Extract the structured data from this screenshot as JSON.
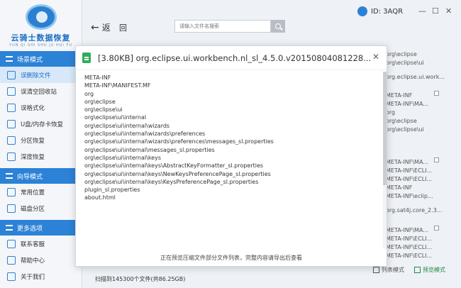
{
  "sidebar": {
    "logo": {
      "title": "云骑士数据恢复",
      "subtitle": "YUN QI SHI SHU JU HUI FU"
    },
    "sections": [
      {
        "title": "场景模式",
        "items": [
          "误删除文件",
          "误清空回收站",
          "误格式化",
          "U盘/内存卡恢复",
          "分区恢复",
          "深度恢复"
        ]
      },
      {
        "title": "向导模式",
        "items": [
          "常用位置",
          "磁盘分区"
        ]
      },
      {
        "title": "更多选项",
        "items": [
          "联系客服",
          "帮助中心",
          "关于我们"
        ]
      }
    ]
  },
  "topbar": {
    "back_label": "返",
    "back_label2": "回",
    "search_placeholder": "请输入文件名搜索",
    "user_id": "ID: 3AQR",
    "min": "—",
    "restore": "☐",
    "close": "✕"
  },
  "right_list": [
    "org\\eclipse",
    "org\\eclipse\\ui",
    "org.eclipse.ui.work...",
    "META-INF",
    "META-INF\\MA...",
    "org",
    "org\\eclipse",
    "org\\eclipse\\ui",
    "META-INF\\MA...",
    "META-INF\\ECLI...",
    "META-INF\\ECLI...",
    "META-INF",
    "META-INF\\eclip...",
    "org.sat4j.core_2.3...",
    "META-INF\\MA...",
    "META-INF\\ECLI...",
    "META-INF\\ECLI...",
    "META-INF\\ECLI..."
  ],
  "status": {
    "scan_text": "扫描到145300个文件(共86.25GB)",
    "list_mode": "列表模式",
    "preview_mode": "预览模式"
  },
  "modal": {
    "title": "[3.80KB] org.eclipse.ui.workbench.nl_sl_4.5.0.v20150804081228...",
    "close": "✕",
    "lines": [
      "META-INF",
      "META-INF\\MANIFEST.MF",
      "org",
      "org\\eclipse",
      "org\\eclipse\\ui",
      "org\\eclipse\\ui\\internal",
      "org\\eclipse\\ui\\internal\\wizards",
      "org\\eclipse\\ui\\internal\\wizards\\preferences",
      "org\\eclipse\\ui\\internal\\wizards\\preferences\\messages_sl.properties",
      "org\\eclipse\\ui\\internal\\messages_sl.properties",
      "org\\eclipse\\ui\\internal\\keys",
      "org\\eclipse\\ui\\internal\\keys\\AbstractKeyFormatter_sl.properties",
      "org\\eclipse\\ui\\internal\\keys\\NewKeysPreferencePage_sl.properties",
      "org\\eclipse\\ui\\internal\\keys\\KeysPreferencePage_sl.properties",
      "plugin_sl.properties",
      "about.html"
    ],
    "footer": "正在预览压缩文件部分文件列表，完整内容请导出后查看"
  }
}
